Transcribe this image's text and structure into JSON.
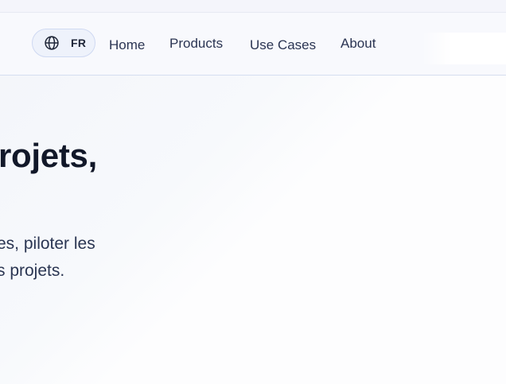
{
  "language_switcher": {
    "icon": "globe-icon",
    "label": "FR"
  },
  "nav": {
    "items": [
      {
        "label": "Home"
      },
      {
        "label": "Products"
      },
      {
        "label": "Use Cases"
      },
      {
        "label": "About"
      }
    ]
  },
  "hero": {
    "title": "rojets,",
    "text_lines": [
      "es, piloter les",
      "s projets."
    ]
  }
}
